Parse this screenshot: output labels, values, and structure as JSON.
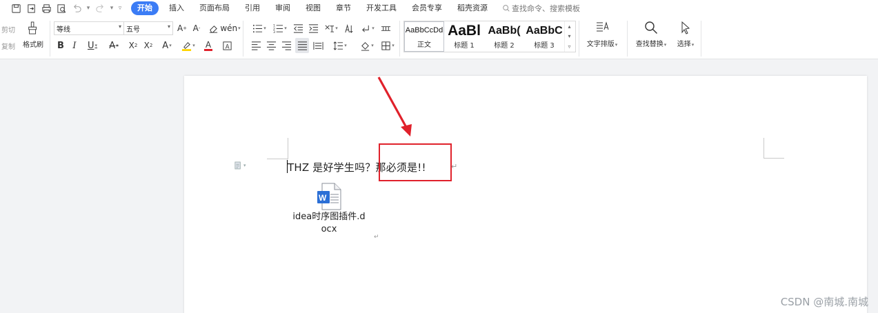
{
  "menubar": {
    "tabs": [
      "开始",
      "插入",
      "页面布局",
      "引用",
      "审阅",
      "视图",
      "章节",
      "开发工具",
      "会员专享",
      "稻壳资源"
    ],
    "active_tab": "开始",
    "search_placeholder": "查找命令、搜索模板"
  },
  "ribbon": {
    "clipboard": {
      "cut": "剪切",
      "copy": "复制",
      "format_painter": "格式刷"
    },
    "font": {
      "family": "等线",
      "size": "五号"
    },
    "styles": [
      {
        "preview": "AaBbCcDd",
        "name": "正文"
      },
      {
        "preview": "AaBl",
        "name": "标题 1"
      },
      {
        "preview": "AaBb(",
        "name": "标题 2"
      },
      {
        "preview": "AaBbC",
        "name": "标题 3"
      }
    ],
    "text_layout": "文字排版",
    "find_replace": "查找替换",
    "select": "选择"
  },
  "document": {
    "line_text": "THZ 是好学生吗？那必须是!!",
    "attachment_filename": "idea时序图插件.docx",
    "attachment_line1": "idea时序图插件.d",
    "attachment_line2": "ocx",
    "paragraph_mark": "↵"
  },
  "watermark": "CSDN @南城.南城",
  "colors": {
    "accent": "#3b7cf5",
    "highlight": "#e0212b",
    "font_red": "#e0212b",
    "highlight_yellow": "#ffd400"
  }
}
